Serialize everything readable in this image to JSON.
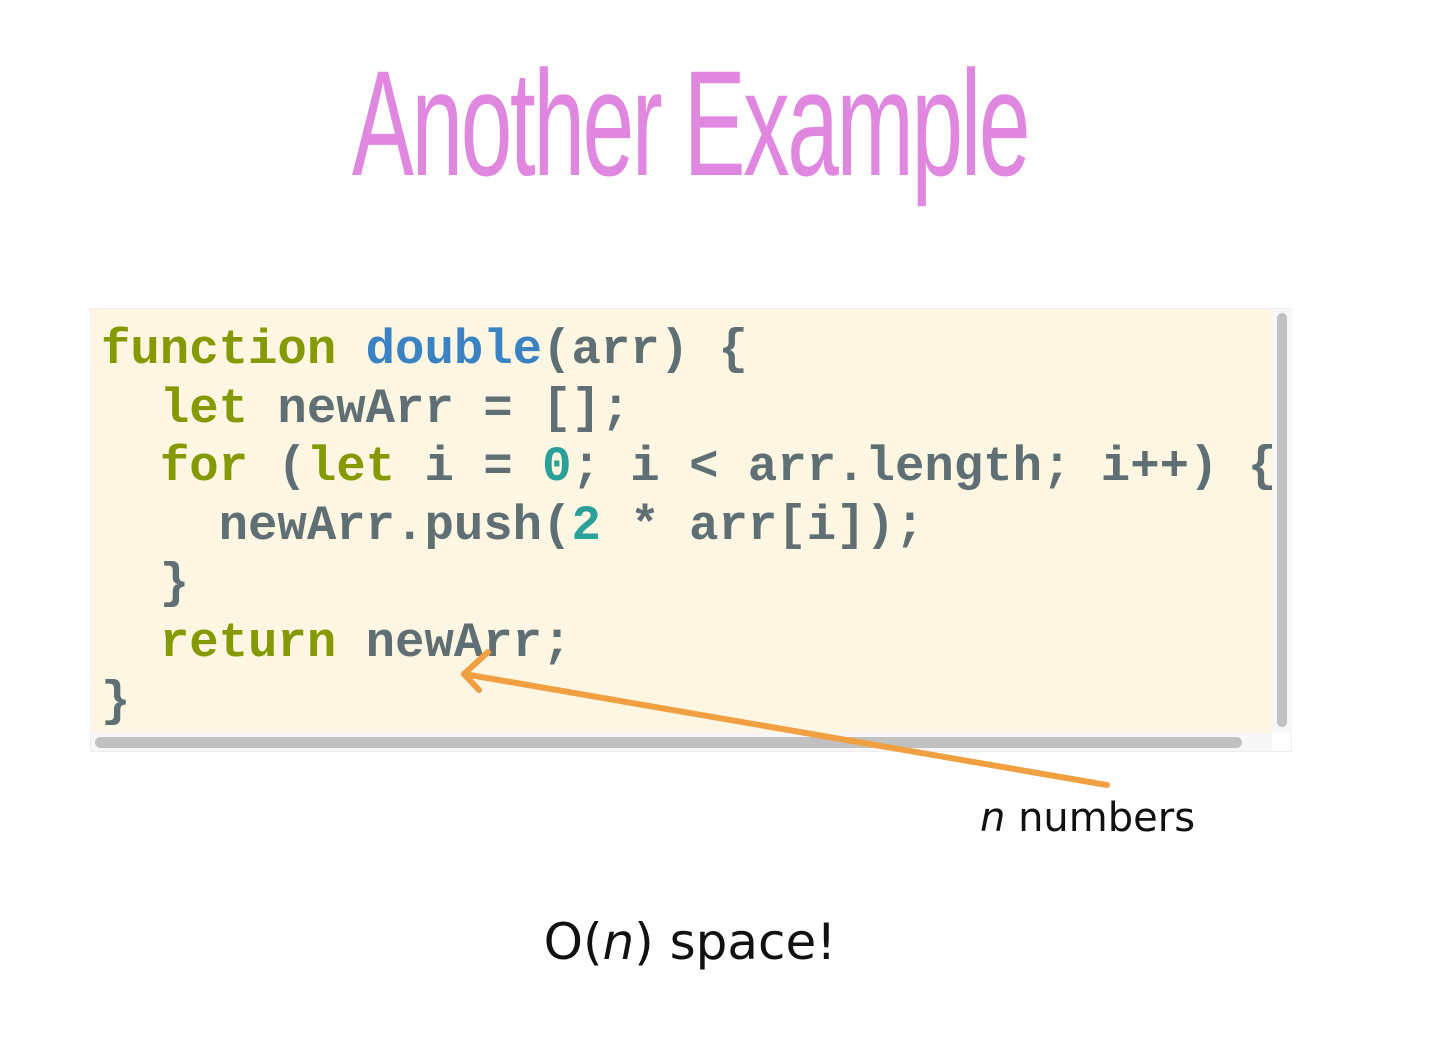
{
  "slide": {
    "title": "Another Example",
    "colors": {
      "title": "#e088e0",
      "code_background": "#fcf6e3",
      "keyword": "#859900",
      "function_name": "#3b82c4",
      "number": "#2aa198",
      "identifier": "#5f6f74",
      "arrow": "#f0a040"
    }
  },
  "code": {
    "language": "javascript",
    "lines": [
      [
        {
          "t": "kw",
          "s": "function"
        },
        {
          "t": "plain",
          "s": " "
        },
        {
          "t": "fn",
          "s": "double"
        },
        {
          "t": "plain",
          "s": "(arr) {"
        }
      ],
      [
        {
          "t": "plain",
          "s": "  "
        },
        {
          "t": "kw",
          "s": "let"
        },
        {
          "t": "plain",
          "s": " newArr = [];"
        }
      ],
      [
        {
          "t": "plain",
          "s": "  "
        },
        {
          "t": "kw",
          "s": "for"
        },
        {
          "t": "plain",
          "s": " ("
        },
        {
          "t": "kw",
          "s": "let"
        },
        {
          "t": "plain",
          "s": " i = "
        },
        {
          "t": "num",
          "s": "0"
        },
        {
          "t": "plain",
          "s": "; i < arr.length; i++) {"
        }
      ],
      [
        {
          "t": "plain",
          "s": "    newArr.push("
        },
        {
          "t": "num",
          "s": "2"
        },
        {
          "t": "plain",
          "s": " * arr[i]);"
        }
      ],
      [
        {
          "t": "plain",
          "s": "  }"
        }
      ],
      [
        {
          "t": "plain",
          "s": "  "
        },
        {
          "t": "kw",
          "s": "return"
        },
        {
          "t": "plain",
          "s": " newArr;"
        }
      ],
      [
        {
          "t": "plain",
          "s": "}"
        }
      ]
    ]
  },
  "annotation": {
    "variable": "n",
    "label": " numbers"
  },
  "conclusion": {
    "prefix": "O(",
    "variable": "n",
    "suffix": ") space!"
  }
}
